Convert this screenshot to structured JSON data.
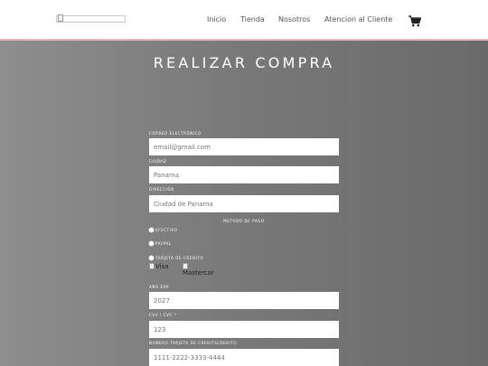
{
  "nav": {
    "logo_alt": "",
    "items": [
      "Inicio",
      "Tienda",
      "Nosotros",
      "Atencion al Cliente"
    ],
    "cart_icon": "shopping-cart-icon"
  },
  "page": {
    "title": "REALIZAR COMPRA"
  },
  "form": {
    "email": {
      "label": "CORREO ELECTRÓNICO",
      "placeholder": "email@gmail.com"
    },
    "city": {
      "label": "CIUDAD",
      "placeholder": "Panama"
    },
    "address": {
      "label": "DIRECCIÓN",
      "placeholder": "Ciudad de Panama"
    },
    "payment": {
      "label": "METODO DE PAGO",
      "options": [
        "EFECTIVO",
        "PAYPAL",
        "TARJETA DE CREDITO"
      ],
      "card_images": [
        "Visa",
        "Mastercar"
      ]
    },
    "year": {
      "label": "AÑO EXP",
      "placeholder": "2027"
    },
    "cvv": {
      "label": "CVV / CVC *",
      "placeholder": "123"
    },
    "card_number": {
      "label": "NUMERO TARJETA DE CREDITO/DEBITO",
      "placeholder": "1111-2222-3333-4444"
    }
  },
  "colors": {
    "topbar": "#ffffff",
    "topbar_border": "#e2b6bf",
    "background": "#7a7a7a"
  }
}
